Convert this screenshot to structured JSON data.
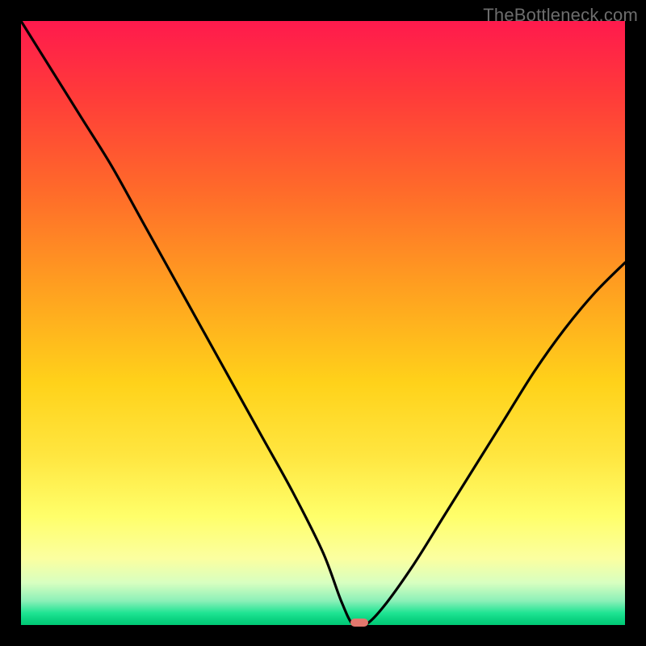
{
  "watermark": "TheBottleneck.com",
  "colors": {
    "frame_bg": "#000000",
    "curve_stroke": "#000000",
    "marker_fill": "#e2776d",
    "gradient_top": "#ff1a4d",
    "gradient_bottom": "#00c874"
  },
  "chart_data": {
    "type": "line",
    "title": "",
    "xlabel": "",
    "ylabel": "",
    "xlim": [
      0,
      100
    ],
    "ylim": [
      0,
      100
    ],
    "grid": false,
    "legend": false,
    "series": [
      {
        "name": "bottleneck-curve",
        "x": [
          0,
          5,
          10,
          15,
          20,
          25,
          30,
          35,
          40,
          45,
          50,
          53,
          55,
          57,
          60,
          65,
          70,
          75,
          80,
          85,
          90,
          95,
          100
        ],
        "values": [
          100,
          92,
          84,
          76,
          67,
          58,
          49,
          40,
          31,
          22,
          12,
          4,
          0,
          0,
          3,
          10,
          18,
          26,
          34,
          42,
          49,
          55,
          60
        ]
      }
    ],
    "marker": {
      "x": 56,
      "y": 0.4,
      "shape": "pill",
      "color": "#e2776d"
    },
    "background_gradient": {
      "direction": "top-to-bottom",
      "stops": [
        {
          "pos": 0,
          "color": "#ff1a4d"
        },
        {
          "pos": 0.12,
          "color": "#ff3a3a"
        },
        {
          "pos": 0.28,
          "color": "#ff6a2a"
        },
        {
          "pos": 0.44,
          "color": "#ff9f20"
        },
        {
          "pos": 0.6,
          "color": "#ffd21a"
        },
        {
          "pos": 0.72,
          "color": "#ffe640"
        },
        {
          "pos": 0.82,
          "color": "#ffff6a"
        },
        {
          "pos": 0.89,
          "color": "#fbffa0"
        },
        {
          "pos": 0.93,
          "color": "#d8ffc0"
        },
        {
          "pos": 0.96,
          "color": "#8cf0b8"
        },
        {
          "pos": 0.98,
          "color": "#1fe493"
        },
        {
          "pos": 0.99,
          "color": "#0cd482"
        },
        {
          "pos": 1.0,
          "color": "#00c874"
        }
      ]
    }
  }
}
